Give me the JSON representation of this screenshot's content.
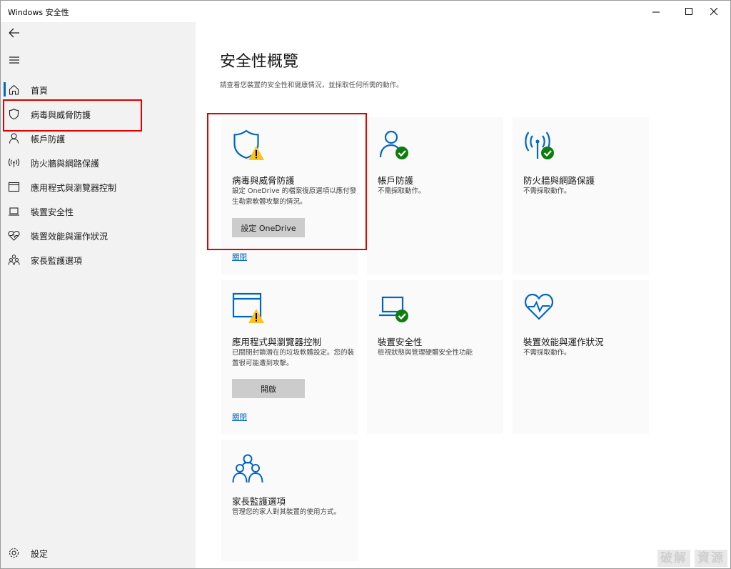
{
  "window": {
    "title": "Windows 安全性"
  },
  "sidebar": {
    "items": [
      {
        "label": "首頁",
        "icon": "home-icon"
      },
      {
        "label": "病毒與威脅防護",
        "icon": "shield-icon"
      },
      {
        "label": "帳戶防護",
        "icon": "person-icon"
      },
      {
        "label": "防火牆與網路保護",
        "icon": "wireless-icon"
      },
      {
        "label": "應用程式與瀏覽器控制",
        "icon": "browser-window-icon"
      },
      {
        "label": "裝置安全性",
        "icon": "laptop-icon"
      },
      {
        "label": "裝置效能與運作狀況",
        "icon": "heart-pulse-icon"
      },
      {
        "label": "家長監護選項",
        "icon": "family-icon"
      }
    ],
    "settings_label": "設定"
  },
  "main": {
    "title": "安全性概覽",
    "description": "請查看您裝置的安全性和健康情況，並採取任何所需的動作。",
    "cards": [
      {
        "title": "病毒與威脅防護",
        "desc": "設定 OneDrive 的檔案復原選項以應付發生勒索軟體攻擊的情況。",
        "button": "設定 OneDrive",
        "link": "關閉",
        "status": "warning"
      },
      {
        "title": "帳戶防護",
        "desc": "不需採取動作。",
        "status": "ok"
      },
      {
        "title": "防火牆與網路保護",
        "desc": "不需採取動作。",
        "status": "ok"
      },
      {
        "title": "應用程式與瀏覽器控制",
        "desc": "已關閉封鎖潛在的垃圾軟體設定。您的裝置很可能遭到攻擊。",
        "button": "開啟",
        "link": "關閉",
        "status": "warning"
      },
      {
        "title": "裝置安全性",
        "desc": "檢視狀態與管理硬體安全性功能",
        "status": "ok"
      },
      {
        "title": "裝置效能與運作狀況",
        "desc": "不需採取動作。",
        "status": "ok"
      },
      {
        "title": "家長監護選項",
        "desc": "管理您的家人對其裝置的使用方式。",
        "status": "none"
      }
    ]
  },
  "watermark": {
    "left": "破解",
    "right": "資源"
  },
  "colors": {
    "accent": "#0067c0",
    "ok": "#107c10",
    "warning": "#fcc21b",
    "highlight": "#e00000"
  }
}
